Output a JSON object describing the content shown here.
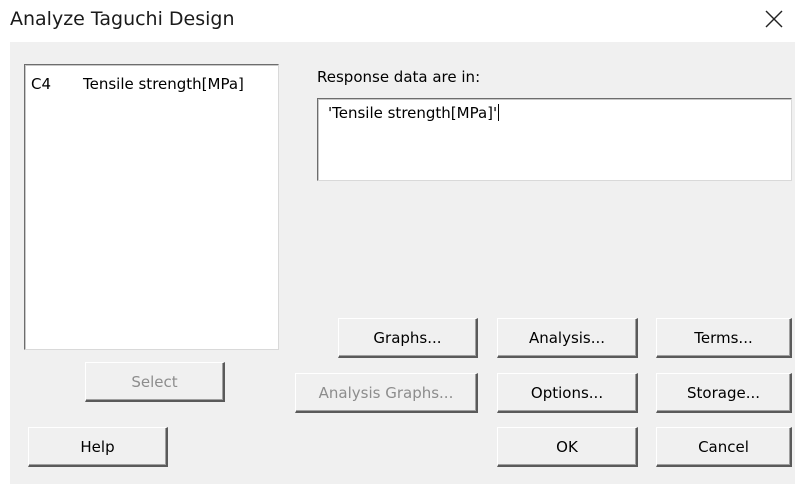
{
  "window": {
    "title": "Analyze Taguchi Design"
  },
  "variables": {
    "items": [
      {
        "column": "C4",
        "name": "Tensile strength[MPa]"
      }
    ]
  },
  "response": {
    "label": "Response data are in:",
    "value": "'Tensile strength[MPa]'"
  },
  "buttons": {
    "select": "Select",
    "graphs": "Graphs...",
    "analysis": "Analysis...",
    "terms": "Terms...",
    "analysis_graphs": "Analysis Graphs...",
    "options": "Options...",
    "storage": "Storage...",
    "help": "Help",
    "ok": "OK",
    "cancel": "Cancel"
  },
  "colors": {
    "dialog_background": "#f0f0f0",
    "disabled_text": "#8d8d8d"
  }
}
